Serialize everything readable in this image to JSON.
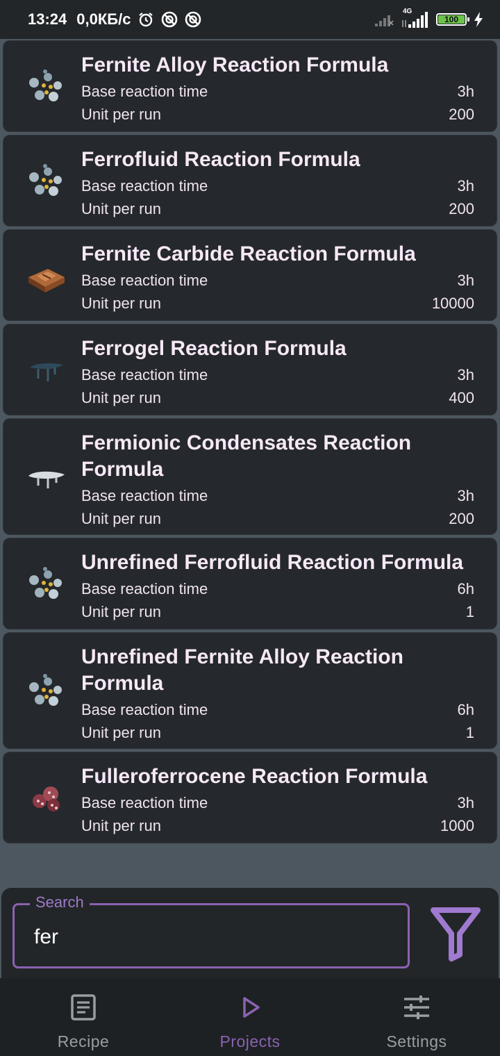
{
  "status_bar": {
    "time": "13:24",
    "speed": "0,0КБ/с",
    "network": "4G",
    "battery": "100",
    "icons": [
      "alarm-icon",
      "blocked-icon",
      "blocked-icon",
      "signal-icon",
      "signal-icon",
      "battery-icon",
      "charging-icon"
    ]
  },
  "recipes": [
    {
      "title": "Fernite Alloy Reaction Formula",
      "time_label": "Base reaction time",
      "time": "3h",
      "units_label": "Unit per run",
      "units": "200",
      "icon": "molecule-icon"
    },
    {
      "title": "Ferrofluid Reaction Formula",
      "time_label": "Base reaction time",
      "time": "3h",
      "units_label": "Unit per run",
      "units": "200",
      "icon": "molecule-icon"
    },
    {
      "title": "Fernite Carbide Reaction Formula",
      "time_label": "Base reaction time",
      "time": "3h",
      "units_label": "Unit per run",
      "units": "10000",
      "icon": "carbide-block-icon"
    },
    {
      "title": "Ferrogel Reaction Formula",
      "time_label": "Base reaction time",
      "time": "3h",
      "units_label": "Unit per run",
      "units": "400",
      "icon": "gel-dark-icon"
    },
    {
      "title": "Fermionic Condensates Reaction Formula",
      "time_label": "Base reaction time",
      "time": "3h",
      "units_label": "Unit per run",
      "units": "200",
      "icon": "gel-light-icon"
    },
    {
      "title": "Unrefined Ferrofluid Reaction Formula",
      "time_label": "Base reaction time",
      "time": "6h",
      "units_label": "Unit per run",
      "units": "1",
      "icon": "molecule-icon"
    },
    {
      "title": "Unrefined Fernite Alloy Reaction Formula",
      "time_label": "Base reaction time",
      "time": "6h",
      "units_label": "Unit per run",
      "units": "1",
      "icon": "molecule-icon"
    },
    {
      "title": "Fulleroferrocene Reaction Formula",
      "time_label": "Base reaction time",
      "time": "3h",
      "units_label": "Unit per run",
      "units": "1000",
      "icon": "fullerene-cluster-icon"
    }
  ],
  "search": {
    "label": "Search",
    "value": "fer",
    "filter_icon": "filter-icon"
  },
  "nav": {
    "items": [
      {
        "label": "Recipe",
        "icon": "recipe-icon",
        "active": false
      },
      {
        "label": "Projects",
        "icon": "play-icon",
        "active": true
      },
      {
        "label": "Settings",
        "icon": "sliders-icon",
        "active": false
      }
    ]
  },
  "colors": {
    "background": "#4c575f",
    "card": "#25282c",
    "accent": "#8a63b0",
    "text": "#f3e6f4"
  }
}
